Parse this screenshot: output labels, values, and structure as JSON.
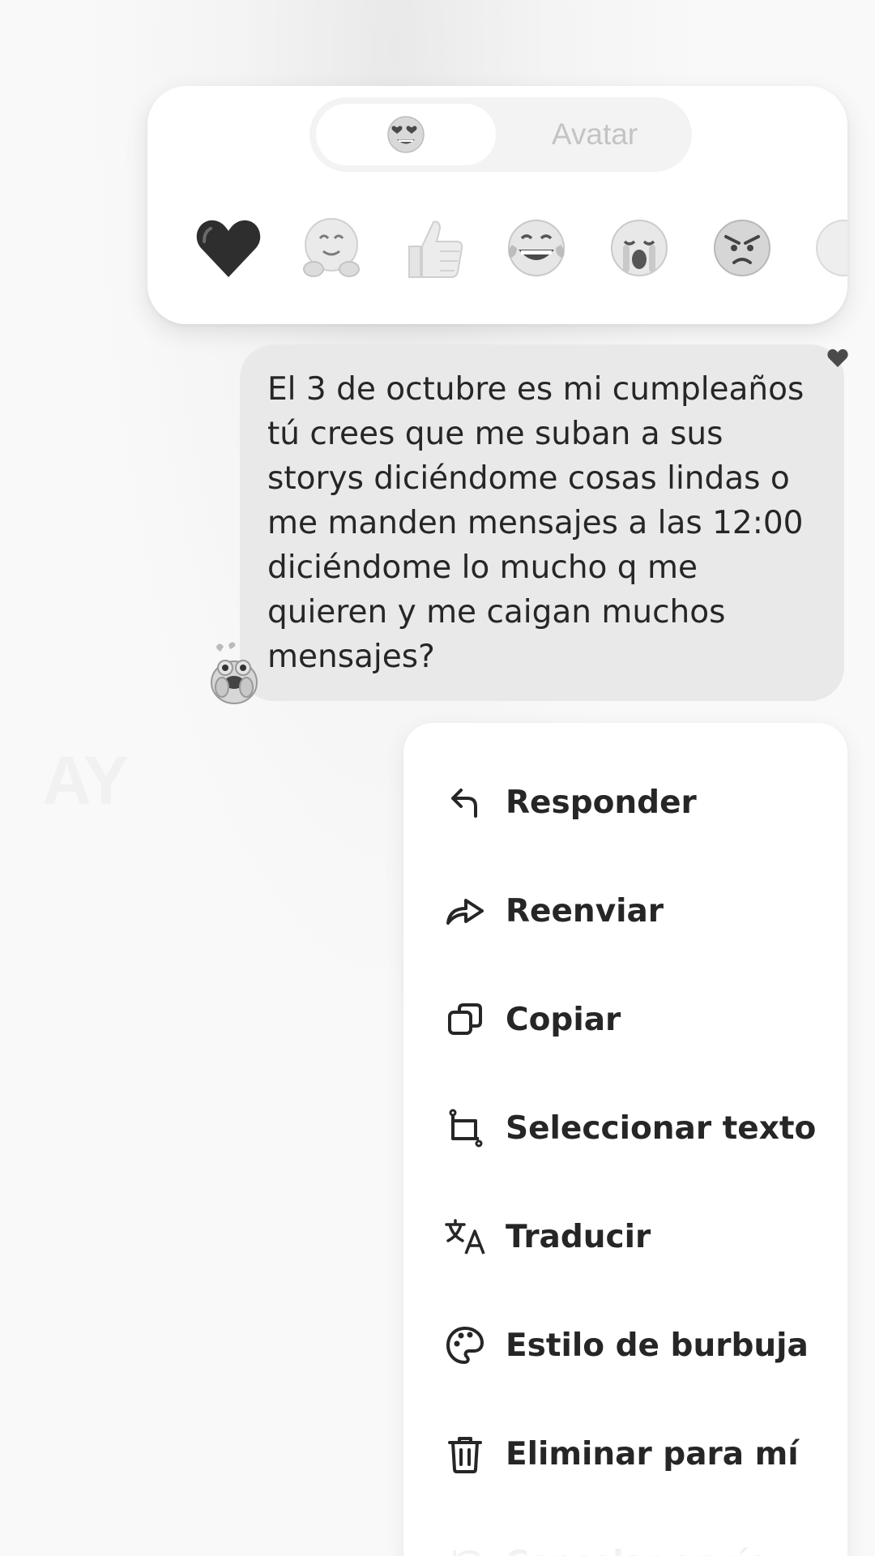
{
  "reaction_panel": {
    "tabs": [
      {
        "icon": "heart-eyes-emoji-icon",
        "selected": true
      },
      {
        "label": "Avatar",
        "selected": false
      }
    ],
    "reactions": [
      {
        "icon": "heart-icon"
      },
      {
        "icon": "hugging-face-icon"
      },
      {
        "icon": "thumbs-up-icon"
      },
      {
        "icon": "tears-of-joy-icon"
      },
      {
        "icon": "crying-face-icon"
      },
      {
        "icon": "angry-face-icon"
      },
      {
        "icon": "more-emoji-icon"
      }
    ]
  },
  "message": {
    "text": "El 3 de octubre es mi cumpleaños\ntú crees que me suban a sus\nstorys diciéndome cosas lindas o\nme manden mensajes a las 12:00\ndiciéndome lo mucho q me\nquieren y me caigan muchos\nmensajes?",
    "reaction_icon": "heart-icon",
    "sticker_icon": "frog-sticker-icon"
  },
  "background_text": "AY",
  "menu": {
    "items": [
      {
        "label": "Responder",
        "icon": "reply-icon"
      },
      {
        "label": "Reenviar",
        "icon": "forward-icon"
      },
      {
        "label": "Copiar",
        "icon": "copy-icon"
      },
      {
        "label": "Seleccionar texto",
        "icon": "select-text-icon"
      },
      {
        "label": "Traducir",
        "icon": "translate-icon"
      },
      {
        "label": "Estilo de burbuja",
        "icon": "palette-icon"
      },
      {
        "label": "Eliminar para mí",
        "icon": "trash-icon"
      },
      {
        "label": "Cancelar envío",
        "icon": "undo-icon"
      }
    ]
  }
}
